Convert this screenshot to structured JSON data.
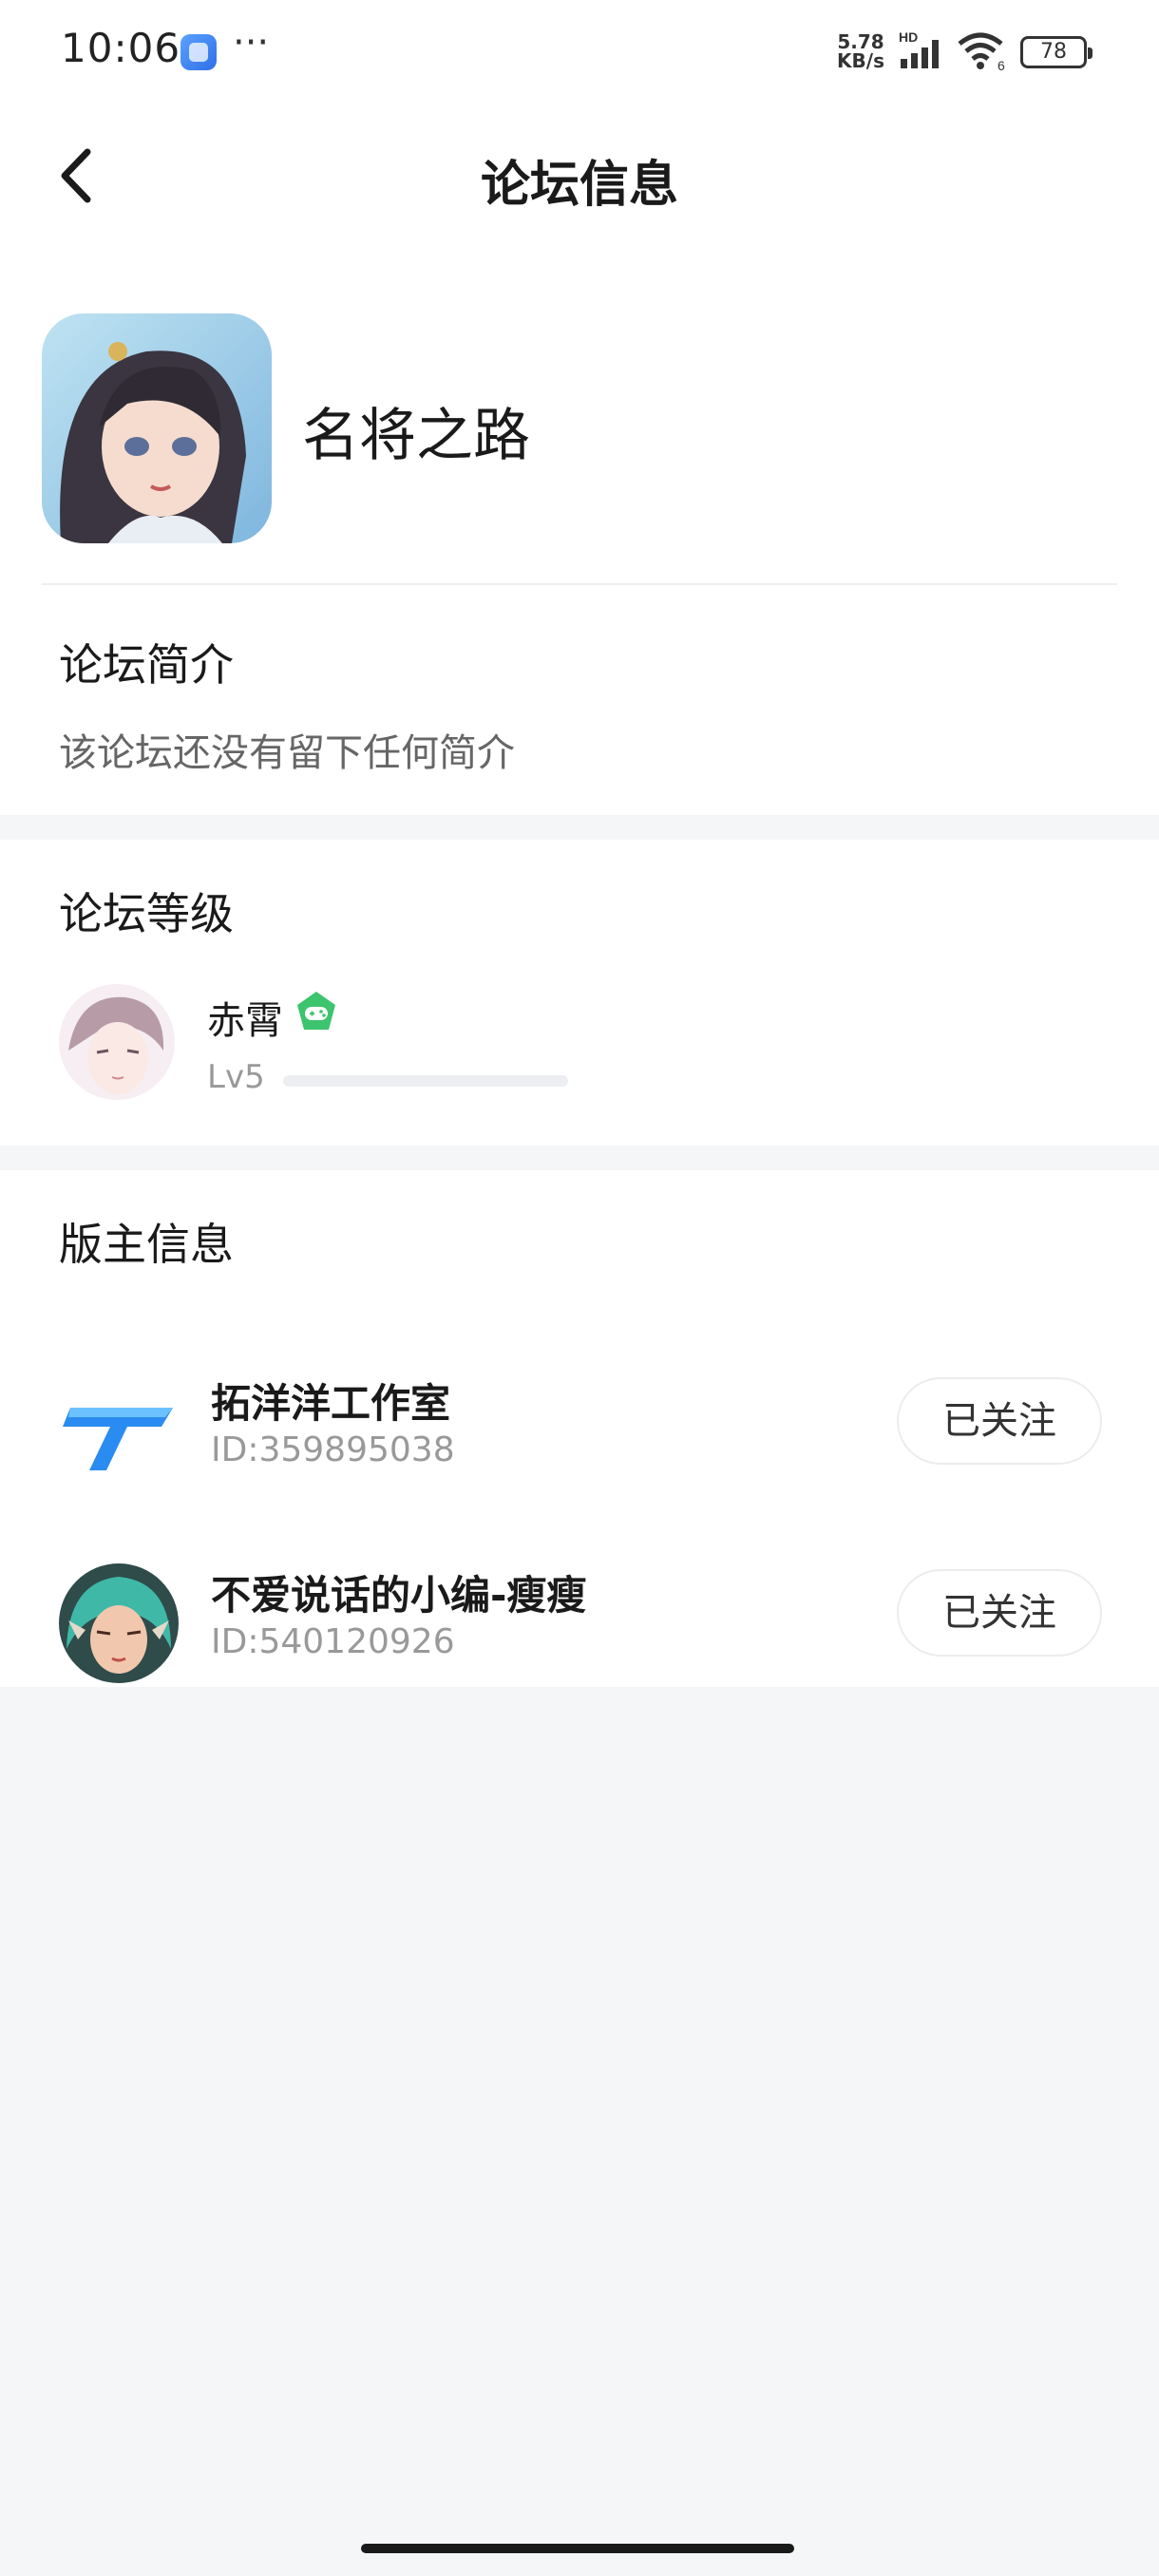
{
  "status_bar": {
    "time": "10:06",
    "more": "···",
    "net_speed_value": "5.78",
    "net_speed_unit": "KB/s",
    "signal_label": "HD",
    "wifi_label": "6",
    "battery": "78"
  },
  "header": {
    "title": "论坛信息"
  },
  "forum": {
    "name": "名将之路",
    "intro_title": "论坛简介",
    "intro_text": "该论坛还没有留下任何简介"
  },
  "level": {
    "section_title": "论坛等级",
    "user_name": "赤霄",
    "level_label": "Lv5",
    "progress": 0.0
  },
  "moderators": {
    "section_title": "版主信息",
    "items": [
      {
        "name": "拓洋洋工作室",
        "id": "ID:359895038",
        "follow_label": "已关注"
      },
      {
        "name": "不爱说话的小编-瘦瘦",
        "id": "ID:540120926",
        "follow_label": "已关注"
      }
    ]
  },
  "colors": {
    "background": "#f5f6f8",
    "card": "#ffffff",
    "badge_green": "#3cc46e",
    "brand_blue": "#2a8cf0"
  },
  "icons": {
    "back": "chevron-left-icon",
    "badge": "gamepad-badge-icon"
  }
}
